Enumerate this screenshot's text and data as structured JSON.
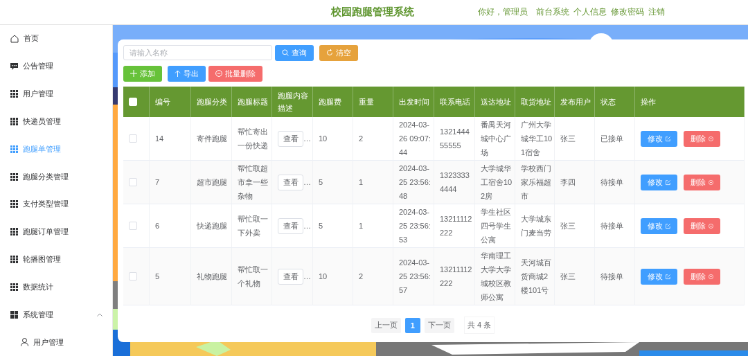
{
  "header": {
    "title": "校园跑腿管理系统",
    "greeting": "你好，管理员",
    "links": [
      "前台系统",
      "个人信息",
      "修改密码",
      "注销"
    ]
  },
  "sidebar": {
    "items": [
      {
        "label": "首页",
        "selected": false
      },
      {
        "label": "公告管理",
        "selected": false
      },
      {
        "label": "用户管理",
        "selected": false
      },
      {
        "label": "快递员管理",
        "selected": false
      },
      {
        "label": "跑腿单管理",
        "selected": true
      },
      {
        "label": "跑腿分类管理",
        "selected": false
      },
      {
        "label": "支付类型管理",
        "selected": false
      },
      {
        "label": "跑腿订单管理",
        "selected": false
      },
      {
        "label": "轮播图管理",
        "selected": false
      },
      {
        "label": "数据统计",
        "selected": false
      },
      {
        "label": "系统管理",
        "selected": false,
        "expanded": true,
        "children": [
          {
            "label": "用户管理",
            "selected": false
          }
        ]
      }
    ]
  },
  "toolbar": {
    "search": {
      "placeholder": "请输入名称"
    },
    "buttons": [
      {
        "label": "查询",
        "kind": "search"
      },
      {
        "label": "清空",
        "kind": "reset"
      }
    ],
    "actions": [
      {
        "label": "添加",
        "kind": "add"
      },
      {
        "label": "导出",
        "kind": "export"
      },
      {
        "label": "批量删除",
        "kind": "delete"
      }
    ]
  },
  "table": {
    "select_all": {
      "checked": false
    },
    "columns": [
      "编号",
      "跑腿分类",
      "跑腿标题",
      "跑腿内容描述",
      "跑腿费",
      "重量",
      "出发时间",
      "联系电话",
      "送达地址",
      "取货地址",
      "发布用户",
      "状态",
      "操作"
    ],
    "rows": [
      {
        "checked": false,
        "id": "14",
        "category": "寄件跑腿",
        "title": "帮忙寄出一份快递",
        "content_button": "查看",
        "content_more": "…",
        "fee": "10",
        "weight": "2",
        "departure_time": "2024-03-26 09:07:44",
        "phone": "132144455555",
        "deliver_to": "番禺天河城中心广场",
        "pickup_at": "广州大学城华工101宿舍",
        "publisher": "张三",
        "status": "已接单",
        "edit": "修改",
        "delete": "删除"
      },
      {
        "checked": false,
        "id": "7",
        "category": "超市跑腿",
        "title": "帮忙取超市拿一些杂物",
        "content_button": "查看",
        "content_more": "…",
        "fee": "5",
        "weight": "1",
        "departure_time": "2024-03-25 23:56:48",
        "phone": "13233334444",
        "deliver_to": "大学城华工宿舍102房",
        "pickup_at": "学校西门家乐福超市",
        "publisher": "李四",
        "status": "待接单",
        "edit": "修改",
        "delete": "删除"
      },
      {
        "checked": false,
        "id": "6",
        "category": "快递跑腿",
        "title": "帮忙取一下外卖",
        "content_button": "查看",
        "content_more": "…",
        "fee": "5",
        "weight": "1",
        "departure_time": "2024-03-25 23:56:53",
        "phone": "13211112222",
        "deliver_to": "学生社区四号学生公寓",
        "pickup_at": "大学城东门麦当劳",
        "publisher": "张三",
        "status": "待接单",
        "edit": "修改",
        "delete": "删除"
      },
      {
        "checked": false,
        "id": "5",
        "category": "礼物跑腿",
        "title": "帮忙取一个礼物",
        "content_button": "查看",
        "content_more": "…",
        "fee": "10",
        "weight": "2",
        "departure_time": "2024-03-25 23:56:57",
        "phone": "13211112222",
        "deliver_to": "华南理工大学大学城校区教师公寓",
        "pickup_at": "天河城百货商城2楼101号",
        "publisher": "张三",
        "status": "待接单",
        "edit": "修改",
        "delete": "删除"
      }
    ]
  },
  "pagination": {
    "prev": "上一页",
    "pages": [
      {
        "label": "1",
        "selected": true
      }
    ],
    "next": "下一页",
    "total": "共 4 条"
  }
}
